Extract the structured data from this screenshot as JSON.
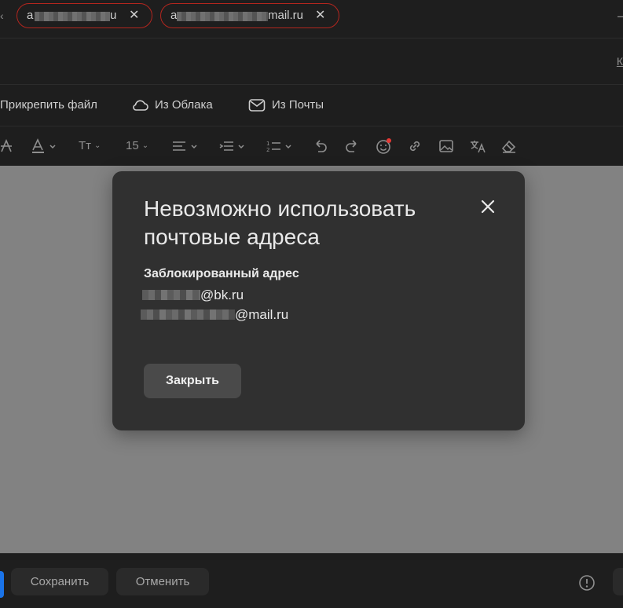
{
  "recipients": [
    {
      "visible_text": "a",
      "visible_suffix": "u"
    },
    {
      "visible_text": "a",
      "visible_suffix": "mail.ru"
    }
  ],
  "edge_link_text": "К",
  "attach_toolbar": {
    "attach_file": "Прикрепить файл",
    "from_cloud": "Из Облака",
    "from_mail": "Из Почты"
  },
  "format_toolbar": {
    "font_size": "15",
    "text_size_label": "Тт"
  },
  "modal": {
    "title": "Невозможно использовать почтовые адреса",
    "subtitle": "Заблокированный адрес",
    "addresses": [
      "@bk.ru",
      "@mail.ru"
    ],
    "close_label": "Закрыть"
  },
  "bottom_bar": {
    "save_label": "Сохранить",
    "cancel_label": "Отменить"
  },
  "colors": {
    "accent_blue": "#1a73e8",
    "chip_error_border": "#b3261e",
    "overlay": "#828282",
    "modal_bg": "#303030"
  }
}
